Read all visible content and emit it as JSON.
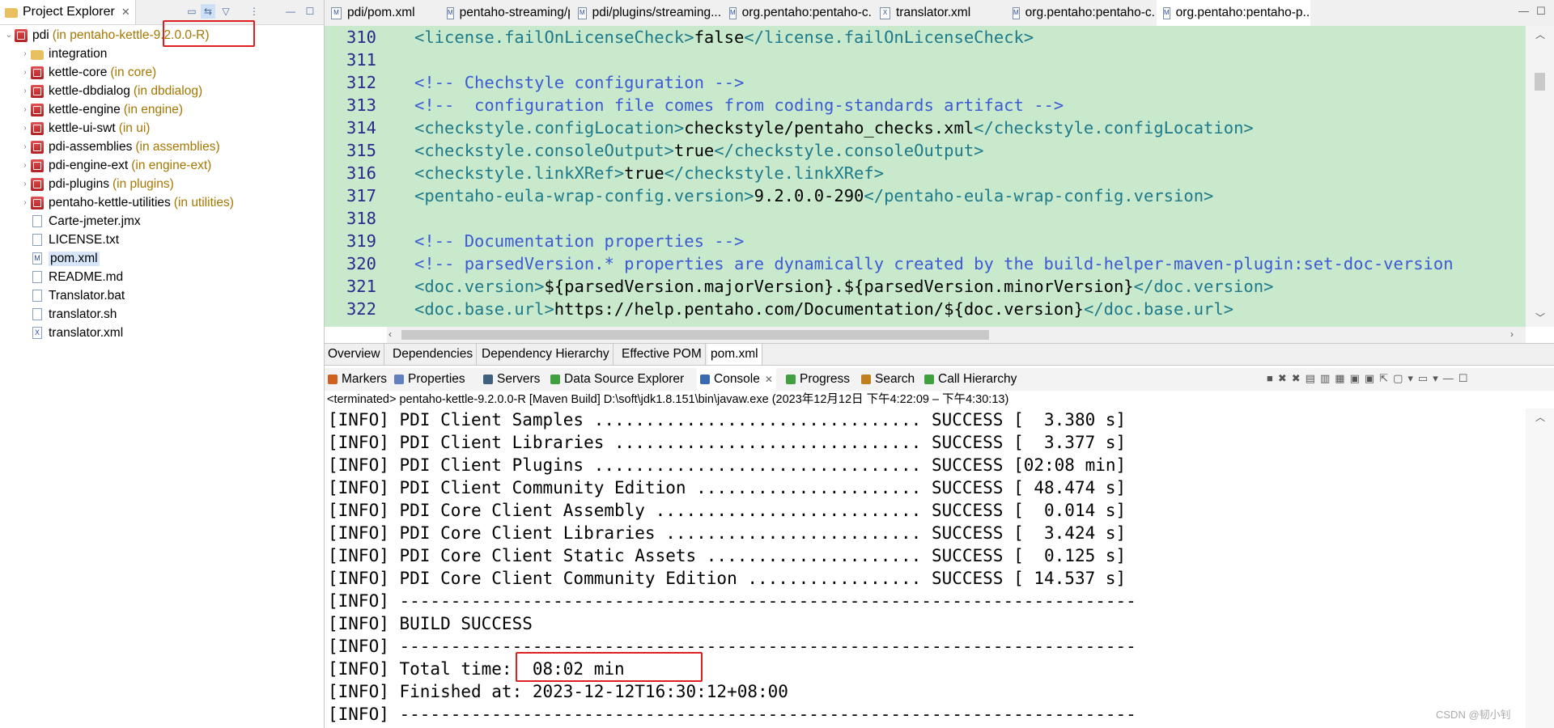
{
  "project_explorer": {
    "title": "Project Explorer",
    "close": "✕",
    "items": [
      {
        "name": "pdi",
        "qualifier": "(in pentaho-kettle-9.2.0.0-R)",
        "icon": "project-icon",
        "level": 0,
        "expanded": true
      },
      {
        "name": "integration",
        "qualifier": "",
        "icon": "folder-icon",
        "level": 1
      },
      {
        "name": "kettle-core",
        "qualifier": "(in core)",
        "icon": "project-icon",
        "level": 1
      },
      {
        "name": "kettle-dbdialog",
        "qualifier": "(in dbdialog)",
        "icon": "project-icon",
        "level": 1
      },
      {
        "name": "kettle-engine",
        "qualifier": "(in engine)",
        "icon": "project-icon",
        "level": 1
      },
      {
        "name": "kettle-ui-swt",
        "qualifier": "(in ui)",
        "icon": "project-icon",
        "level": 1
      },
      {
        "name": "pdi-assemblies",
        "qualifier": "(in assemblies)",
        "icon": "project-icon",
        "level": 1
      },
      {
        "name": "pdi-engine-ext",
        "qualifier": "(in engine-ext)",
        "icon": "project-icon",
        "level": 1
      },
      {
        "name": "pdi-plugins",
        "qualifier": "(in plugins)",
        "icon": "project-icon",
        "level": 1
      },
      {
        "name": "pentaho-kettle-utilities",
        "qualifier": "(in utilities)",
        "icon": "project-icon",
        "level": 1
      },
      {
        "name": "Carte-jmeter.jmx",
        "qualifier": "",
        "icon": "file-icon",
        "level": 1
      },
      {
        "name": "LICENSE.txt",
        "qualifier": "",
        "icon": "file-icon",
        "level": 1
      },
      {
        "name": "pom.xml",
        "qualifier": "",
        "icon": "pom-icon",
        "level": 1,
        "selected": true
      },
      {
        "name": "README.md",
        "qualifier": "",
        "icon": "file-icon",
        "level": 1
      },
      {
        "name": "Translator.bat",
        "qualifier": "",
        "icon": "file-icon",
        "level": 1
      },
      {
        "name": "translator.sh",
        "qualifier": "",
        "icon": "file-icon",
        "level": 1
      },
      {
        "name": "translator.xml",
        "qualifier": "",
        "icon": "xml-icon",
        "level": 1
      }
    ]
  },
  "editor": {
    "tabs": [
      {
        "label": "pdi/pom.xml"
      },
      {
        "label": "pentaho-streaming/po..."
      },
      {
        "label": "pdi/plugins/streaming..."
      },
      {
        "label": "org.pentaho:pentaho-c..."
      },
      {
        "label": "translator.xml"
      },
      {
        "label": "org.pentaho:pentaho-c..."
      },
      {
        "label": "org.pentaho:pentaho-p...",
        "active": true
      }
    ],
    "close": "✕",
    "minimize": "—",
    "maximize": "☐",
    "lines": [
      {
        "n": "310",
        "parts": [
          [
            "tg",
            "<license.failOnLicenseCheck>"
          ],
          [
            "tx",
            "false"
          ],
          [
            "tg",
            "</license.failOnLicenseCheck>"
          ]
        ]
      },
      {
        "n": "311",
        "parts": []
      },
      {
        "n": "312",
        "parts": [
          [
            "cm",
            "<!-- Chechstyle configuration -->"
          ]
        ]
      },
      {
        "n": "313",
        "parts": [
          [
            "cm",
            "<!--  configuration file comes from coding-standards artifact -->"
          ]
        ]
      },
      {
        "n": "314",
        "parts": [
          [
            "tg",
            "<checkstyle.configLocation>"
          ],
          [
            "tx",
            "checkstyle/pentaho_checks.xml"
          ],
          [
            "tg",
            "</checkstyle.configLocation>"
          ]
        ]
      },
      {
        "n": "315",
        "parts": [
          [
            "tg",
            "<checkstyle.consoleOutput>"
          ],
          [
            "tx",
            "true"
          ],
          [
            "tg",
            "</checkstyle.consoleOutput>"
          ]
        ]
      },
      {
        "n": "316",
        "parts": [
          [
            "tg",
            "<checkstyle.linkXRef>"
          ],
          [
            "tx",
            "true"
          ],
          [
            "tg",
            "</checkstyle.linkXRef>"
          ]
        ]
      },
      {
        "n": "317",
        "parts": [
          [
            "tg",
            "<pentaho-eula-wrap-config.version>"
          ],
          [
            "tx",
            "9.2.0.0-290"
          ],
          [
            "tg",
            "</pentaho-eula-wrap-config.version>"
          ]
        ]
      },
      {
        "n": "318",
        "parts": []
      },
      {
        "n": "319",
        "parts": [
          [
            "cm",
            "<!-- Documentation properties -->"
          ]
        ]
      },
      {
        "n": "320",
        "parts": [
          [
            "cm",
            "<!-- parsedVersion.* properties are dynamically created by the build-helper-maven-plugin:set-doc-version"
          ]
        ]
      },
      {
        "n": "321",
        "parts": [
          [
            "tg",
            "<doc.version>"
          ],
          [
            "tx",
            "${parsedVersion.majorVersion}.${parsedVersion.minorVersion}"
          ],
          [
            "tg",
            "</doc.version>"
          ]
        ]
      },
      {
        "n": "322",
        "parts": [
          [
            "tg",
            "<doc.base.url>"
          ],
          [
            "tx",
            "https://help.pentaho.com/Documentation/${doc.version}"
          ],
          [
            "tg",
            "</doc.base.url>"
          ]
        ]
      }
    ]
  },
  "pom_tabs": [
    "Overview",
    "Dependencies",
    "Dependency Hierarchy",
    "Effective POM",
    "pom.xml"
  ],
  "console_tabs": [
    {
      "label": "Markers",
      "color": "#d06020"
    },
    {
      "label": "Properties",
      "color": "#6080c0"
    },
    {
      "label": "Servers",
      "color": "#406080"
    },
    {
      "label": "Data Source Explorer",
      "color": "#40a040"
    },
    {
      "label": "Console",
      "color": "#3a6ab0",
      "active": true
    },
    {
      "label": "Progress",
      "color": "#40a040"
    },
    {
      "label": "Search",
      "color": "#c08020"
    },
    {
      "label": "Call Hierarchy",
      "color": "#40a040"
    }
  ],
  "console": {
    "status": "<terminated> pentaho-kettle-9.2.0.0-R [Maven Build] D:\\soft\\jdk1.8.151\\bin\\javaw.exe  (2023年12月12日 下午4:22:09 – 下午4:30:13)",
    "lines": [
      "[INFO] PDI Client Samples ................................ SUCCESS [  3.380 s]",
      "[INFO] PDI Client Libraries .............................. SUCCESS [  3.377 s]",
      "[INFO] PDI Client Plugins ................................ SUCCESS [02:08 min]",
      "[INFO] PDI Client Community Edition ...................... SUCCESS [ 48.474 s]",
      "[INFO] PDI Core Client Assembly .......................... SUCCESS [  0.014 s]",
      "[INFO] PDI Core Client Libraries ......................... SUCCESS [  3.424 s]",
      "[INFO] PDI Core Client Static Assets ..................... SUCCESS [  0.125 s]",
      "[INFO] PDI Core Client Community Edition ................. SUCCESS [ 14.537 s]",
      "[INFO] ------------------------------------------------------------------------",
      "[INFO] BUILD SUCCESS",
      "[INFO] ------------------------------------------------------------------------",
      "[INFO] Total time:  08:02 min",
      "[INFO] Finished at: 2023-12-12T16:30:12+08:00",
      "[INFO] ------------------------------------------------------------------------"
    ]
  },
  "watermark": "CSDN @韧小钊",
  "colors": {
    "editor_bg": "#c9e9cc",
    "highlight": "#e02020",
    "tag": "#1e7a8a",
    "comment": "#3c5ad4"
  }
}
